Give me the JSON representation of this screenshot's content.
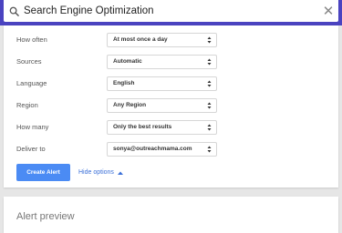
{
  "search": {
    "query": "Search Engine Optimization",
    "icon": "search-icon",
    "clear_icon": "close-icon",
    "clear_glyph": "✕"
  },
  "options": [
    {
      "label": "How often",
      "value": "At most once a day"
    },
    {
      "label": "Sources",
      "value": "Automatic"
    },
    {
      "label": "Language",
      "value": "English"
    },
    {
      "label": "Region",
      "value": "Any Region"
    },
    {
      "label": "How many",
      "value": "Only the best results"
    },
    {
      "label": "Deliver to",
      "value": "sonya@outreachmama.com"
    }
  ],
  "actions": {
    "create_label": "Create Alert",
    "hide_options_label": "Hide options"
  },
  "preview": {
    "title": "Alert preview"
  },
  "colors": {
    "header": "#4a43c0",
    "primary_button": "#4b8bf4",
    "link": "#3a6fd8"
  }
}
